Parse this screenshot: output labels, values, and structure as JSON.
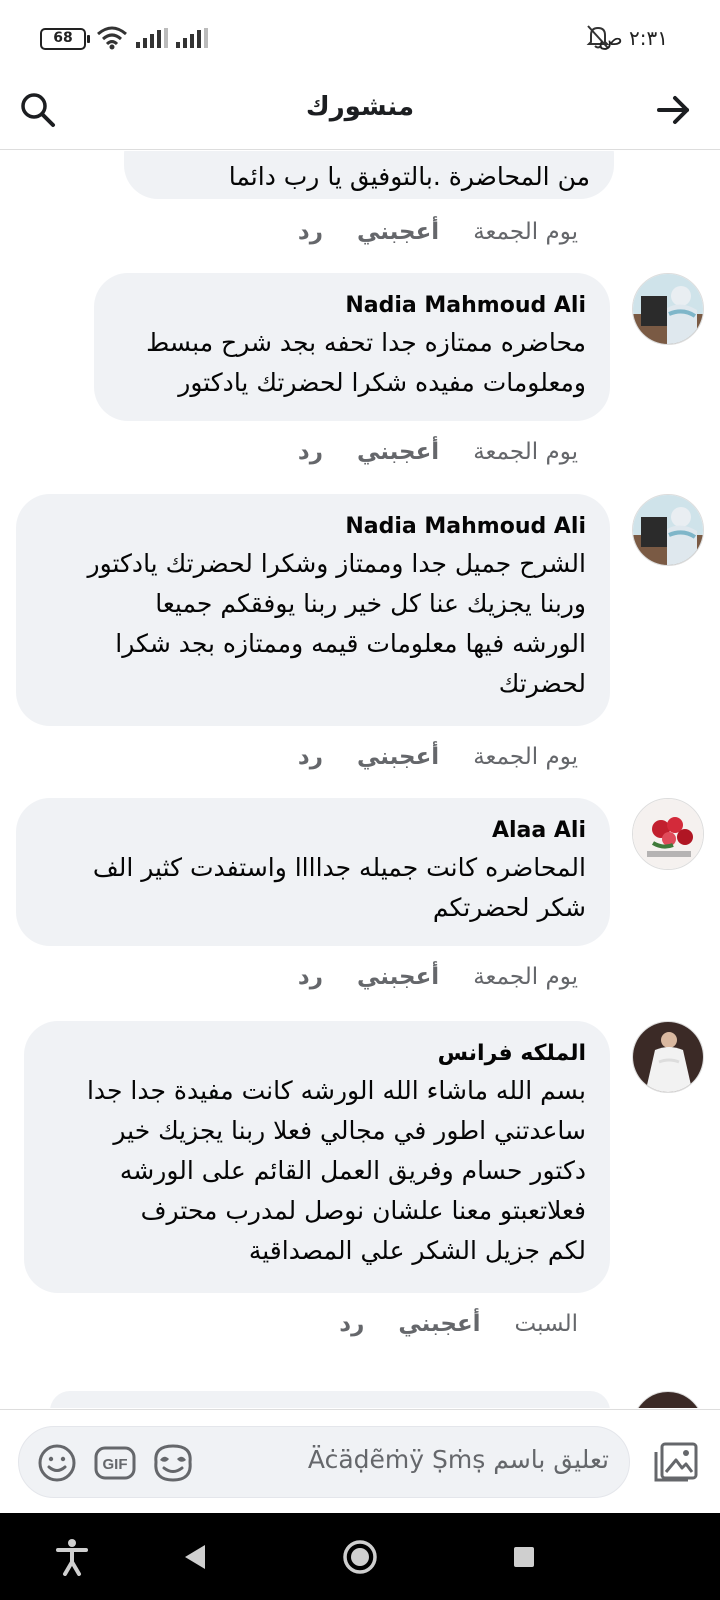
{
  "status": {
    "battery": "68",
    "clock": "٢:٣١ ص"
  },
  "header": {
    "title": "منشورك"
  },
  "top_partial": {
    "text": "من المحاضرة .بالتوفيق يا رب دائما",
    "time": "يوم الجمعة",
    "like": "أعجبني",
    "reply": "رد"
  },
  "comments": [
    {
      "author": "Nadia Mahmoud Ali",
      "text": "محاضره ممتازه جدا تحفه بجد شرح مبسط\nومعلومات مفيده شكرا لحضرتك يادكتور",
      "time": "يوم الجمعة",
      "like": "أعجبني",
      "reply": "رد"
    },
    {
      "author": "Nadia Mahmoud Ali",
      "text": "الشرح جميل جدا وممتاز وشكرا لحضرتك يادكتور\nوربنا يجزيك عنا كل خير ربنا يوفقكم جميعا\nالورشه فيها معلومات قيمه وممتازه بجد شكرا\nلحضرتك",
      "time": "يوم الجمعة",
      "like": "أعجبني",
      "reply": "رد"
    },
    {
      "author": "Alaa Ali",
      "text": "المحاضره كانت جميله جداااا واستفدت كثير الف\nشكر لحضرتكم",
      "time": "يوم الجمعة",
      "like": "أعجبني",
      "reply": "رد"
    },
    {
      "author": "الملكه فرانس",
      "text": "بسم الله ماشاء الله الورشه كانت مفيدة جدا جدا\nساعدتني اطور في مجالي فعلا ربنا يجزيك خير\nدكتور حسام وفريق العمل القائم على الورشه\nفعلاتعبتو معنا علشان نوصل لمدرب محترف\nلكم جزيل الشكر علي المصداقية",
      "time": "السبت",
      "like": "أعجبني",
      "reply": "رد"
    }
  ],
  "composer": {
    "placeholder": "تعليق باسم Äċäḍẽṁÿ Ṣṁṣ",
    "gif_label": "GIF"
  },
  "icons": {
    "back": "arrow-right-icon",
    "search": "search-icon",
    "emoji": "smiley-icon",
    "gif": "gif-icon",
    "sticker": "sticker-icon",
    "photo": "photo-icon"
  }
}
